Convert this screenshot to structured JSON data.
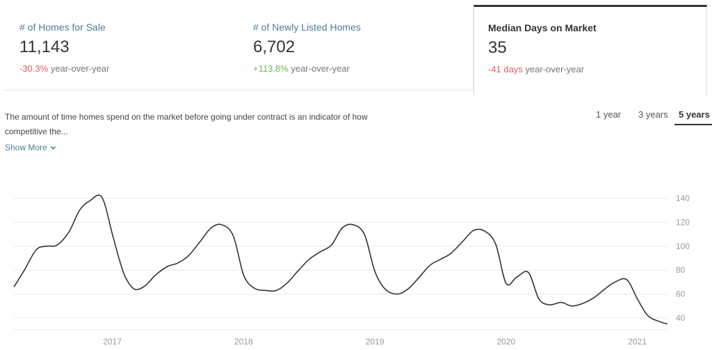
{
  "stats": [
    {
      "label": "# of Homes for Sale",
      "value": "11,143",
      "change": "-30.3%",
      "change_type": "negative",
      "suffix": "year-over-year",
      "selected": false
    },
    {
      "label": "# of Newly Listed Homes",
      "value": "6,702",
      "change": "+113.8%",
      "change_type": "positive",
      "suffix": "year-over-year",
      "selected": false
    },
    {
      "label": "Median Days on Market",
      "value": "35",
      "change": "-41 days",
      "change_type": "negative",
      "suffix": "year-over-year",
      "selected": true
    }
  ],
  "description": "The amount of time homes spend on the market before going under contract is an indicator of how competitive the...",
  "show_more_label": "Show More",
  "time_ranges": [
    {
      "label": "1 year",
      "active": false
    },
    {
      "label": "3 years",
      "active": false
    },
    {
      "label": "5 years",
      "active": true
    }
  ],
  "colors": {
    "accent_blue": "#4d7d96",
    "negative": "#e05d5d",
    "positive": "#6db35d",
    "line": "#333333",
    "grid": "#e8e8e8"
  },
  "chart_data": {
    "type": "line",
    "title": "Median Days on Market",
    "xlabel": "",
    "ylabel": "",
    "x_start": 2016.25,
    "x_end": 2021.23,
    "ylim": [
      33,
      143
    ],
    "yticks": [
      40,
      60,
      80,
      100,
      120,
      140
    ],
    "xticks": [
      {
        "label": "2017",
        "value": 2017
      },
      {
        "label": "2018",
        "value": 2018
      },
      {
        "label": "2019",
        "value": 2019
      },
      {
        "label": "2020",
        "value": 2020
      },
      {
        "label": "2021",
        "value": 2021
      }
    ],
    "grid": true,
    "y_axis_position": "right",
    "series": [
      {
        "name": "Median Days on Market",
        "x": [
          2016.25,
          2016.33,
          2016.42,
          2016.5,
          2016.58,
          2016.67,
          2016.75,
          2016.83,
          2016.92,
          2017.0,
          2017.05,
          2017.1,
          2017.17,
          2017.25,
          2017.33,
          2017.42,
          2017.5,
          2017.58,
          2017.67,
          2017.75,
          2017.83,
          2017.92,
          2018.0,
          2018.08,
          2018.17,
          2018.25,
          2018.33,
          2018.42,
          2018.5,
          2018.58,
          2018.67,
          2018.75,
          2018.83,
          2018.92,
          2019.0,
          2019.08,
          2019.17,
          2019.25,
          2019.33,
          2019.42,
          2019.5,
          2019.58,
          2019.67,
          2019.75,
          2019.83,
          2019.92,
          2020.0,
          2020.08,
          2020.17,
          2020.25,
          2020.33,
          2020.42,
          2020.5,
          2020.58,
          2020.67,
          2020.75,
          2020.83,
          2020.92,
          2021.0,
          2021.08,
          2021.17,
          2021.23
        ],
        "values": [
          66,
          80,
          97,
          100,
          101,
          112,
          130,
          138,
          141,
          110,
          90,
          74,
          64,
          67,
          76,
          83,
          86,
          92,
          104,
          115,
          118,
          109,
          76,
          65,
          63,
          63,
          69,
          80,
          89,
          95,
          101,
          115,
          118,
          110,
          79,
          64,
          60,
          64,
          73,
          84,
          89,
          94,
          104,
          113,
          113,
          102,
          69,
          74,
          78,
          56,
          51,
          53,
          50,
          52,
          57,
          64,
          70,
          72,
          56,
          42,
          37,
          35
        ]
      }
    ]
  }
}
